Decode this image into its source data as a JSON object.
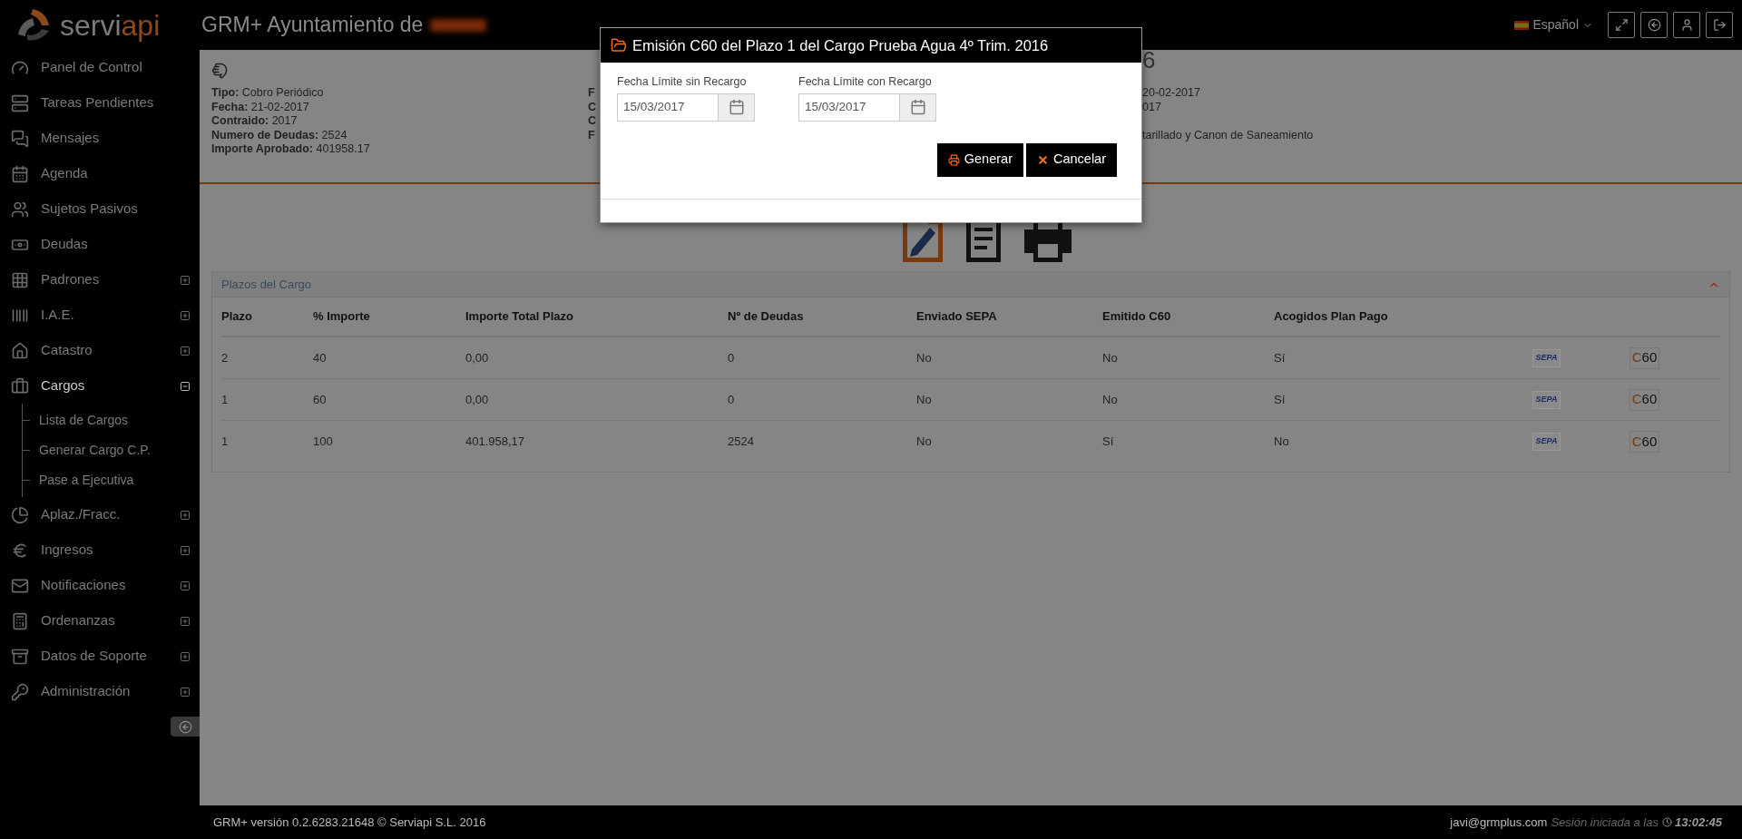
{
  "brand": {
    "part1": "servi",
    "part2": "api"
  },
  "header": {
    "title": "GRM+ Ayuntamiento de",
    "language": "Español"
  },
  "sidebar": {
    "items": [
      {
        "label": "Panel de Control",
        "active": false
      },
      {
        "label": "Tareas Pendientes",
        "active": false
      },
      {
        "label": "Mensajes",
        "active": false
      },
      {
        "label": "Agenda",
        "active": false
      },
      {
        "label": "Sujetos Pasivos",
        "active": false
      },
      {
        "label": "Deudas",
        "active": false
      },
      {
        "label": "Padrones",
        "active": false,
        "expanded": false
      },
      {
        "label": "I.A.E.",
        "active": false,
        "expanded": false
      },
      {
        "label": "Catastro",
        "active": false,
        "expanded": false
      },
      {
        "label": "Cargos",
        "active": true,
        "expanded": true,
        "children": [
          {
            "label": "Lista de Cargos"
          },
          {
            "label": "Generar Cargo C.P."
          },
          {
            "label": "Pase a Ejecutiva"
          }
        ]
      },
      {
        "label": "Aplaz./Fracc.",
        "active": false,
        "expanded": false
      },
      {
        "label": "Ingresos",
        "active": false,
        "expanded": false
      },
      {
        "label": "Notificaciones",
        "active": false,
        "expanded": false
      },
      {
        "label": "Ordenanzas",
        "active": false,
        "expanded": false
      },
      {
        "label": "Datos de Soporte",
        "active": false,
        "expanded": false
      },
      {
        "label": "Administración",
        "active": false,
        "expanded": false
      }
    ]
  },
  "info": {
    "left": [
      {
        "label": "Tipo:",
        "value": "Cobro Periódico"
      },
      {
        "label": "Fecha:",
        "value": "21-02-2017"
      },
      {
        "label": "Contraido:",
        "value": "2017"
      },
      {
        "label": "Numero de Deudas:",
        "value": "2524"
      },
      {
        "label": "Importe Aprobado:",
        "value": "401958.17"
      }
    ],
    "middle_fragments": [
      "F",
      "C",
      "C",
      "F"
    ],
    "heading_fragment": "6",
    "right_fragments": [
      "20-02-2017",
      "017",
      "tarillado y Canon de Saneamiento"
    ]
  },
  "plazos": {
    "title": "Plazos del Cargo",
    "columns": [
      "Plazo",
      "% Importe",
      "Importe Total Plazo",
      "Nº de Deudas",
      "Enviado SEPA",
      "Emitido C60",
      "Acogidos Plan Pago"
    ],
    "rows": [
      {
        "cells": [
          "2",
          "40",
          "0,00",
          "0",
          "No",
          "No",
          "Sí"
        ],
        "actions": [
          "SEPA",
          "C60"
        ]
      },
      {
        "cells": [
          "1",
          "60",
          "0,00",
          "0",
          "No",
          "No",
          "Sí"
        ],
        "actions": [
          "SEPA",
          "C60"
        ]
      },
      {
        "cells": [
          "1",
          "100",
          "401.958,17",
          "2524",
          "No",
          "Sí",
          "No"
        ],
        "actions": [
          "SEPA",
          "C60"
        ]
      }
    ]
  },
  "modal": {
    "title": "Emisión C60 del Plazo 1 del Cargo Prueba Agua 4º Trim. 2016",
    "fields": [
      {
        "label": "Fecha Límite sin Recargo",
        "value": "15/03/2017"
      },
      {
        "label": "Fecha Límite con Recargo",
        "value": "15/03/2017"
      }
    ],
    "buttons": [
      {
        "label": "Generar",
        "kind": "print"
      },
      {
        "label": "Cancelar",
        "kind": "cancel"
      }
    ]
  },
  "footer": {
    "version": "GRM+ versión 0.2.6283.21648 © Serviapi S.L. 2016",
    "email": "javi@grmplus.com",
    "session_label": "Sesión iniciada a las",
    "time": "13:02:45"
  }
}
